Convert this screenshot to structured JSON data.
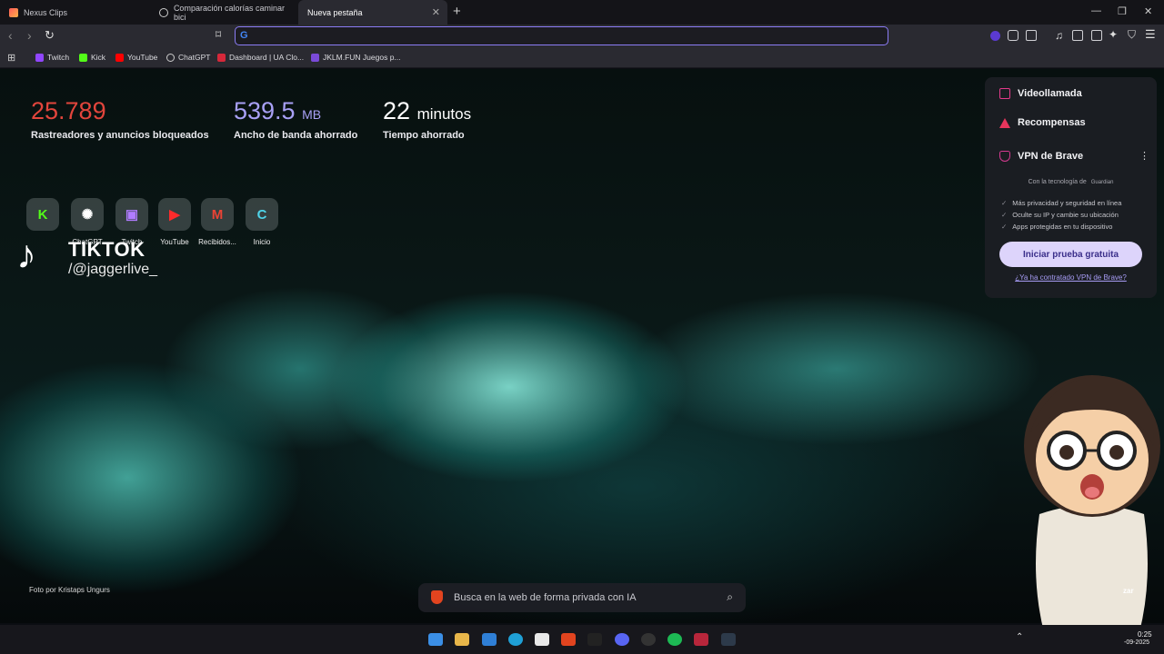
{
  "tabs": [
    {
      "label": "Nexus Clips",
      "icon": "nexus-clips-icon"
    },
    {
      "label": "Comparación calorías caminar bici",
      "icon": "chatgpt-icon"
    },
    {
      "label": "Nueva pestaña",
      "icon": "none",
      "active": true
    }
  ],
  "bookmarks": [
    {
      "label": "Twitch",
      "icon": "twitch-icon"
    },
    {
      "label": "Kick",
      "icon": "kick-icon"
    },
    {
      "label": "YouTube",
      "icon": "youtube-icon"
    },
    {
      "label": "ChatGPT",
      "icon": "chatgpt-icon"
    },
    {
      "label": "Dashboard | UA Clo...",
      "icon": "ua-icon"
    },
    {
      "label": "JKLM.FUN Juegos p...",
      "icon": "jklm-icon"
    }
  ],
  "stats": [
    {
      "value": "25.789",
      "unit": "",
      "label": "Rastreadores y anuncios bloqueados",
      "color": "#e2453c"
    },
    {
      "value": "539.5",
      "unit": "MB",
      "label": "Ancho de banda ahorrado",
      "color": "#a8a0f5"
    },
    {
      "value": "22",
      "unit": "minutos",
      "label": "Tiempo ahorrado",
      "color": "#ffffff"
    }
  ],
  "shortcuts": [
    {
      "label": "",
      "icon": "kick-icon"
    },
    {
      "label": "ChatGPT",
      "icon": "chatgpt-icon"
    },
    {
      "label": "Twitch",
      "icon": "twitch-icon"
    },
    {
      "label": "YouTube",
      "icon": "youtube-icon"
    },
    {
      "label": "Recibidos...",
      "icon": "gmail-icon"
    },
    {
      "label": "Inicio",
      "icon": "canva-icon"
    }
  ],
  "overlay": {
    "tiktok_title": "TIKTOK",
    "tiktok_handle": "/@jaggerlive_"
  },
  "panel": {
    "items": [
      "Videollamada",
      "Recompensas",
      "VPN de Brave"
    ],
    "tech": "Con la tecnología de",
    "tech_brand": "Guardian",
    "bullets": [
      "Más privacidad y seguridad en línea",
      "Oculte su IP y cambie su ubicación",
      "Apps protegidas en tu dispositivo"
    ],
    "trial_button": "Iniciar prueba gratuita",
    "contracted_link": "¿Ya ha contratado VPN de Brave?"
  },
  "search": {
    "placeholder": "Busca en la web de forma privada con IA"
  },
  "credit": "Foto por Kristaps Ungurs",
  "taskbar": {
    "time": "0:25",
    "date": "-09-2025",
    "partial_label": "zar"
  }
}
